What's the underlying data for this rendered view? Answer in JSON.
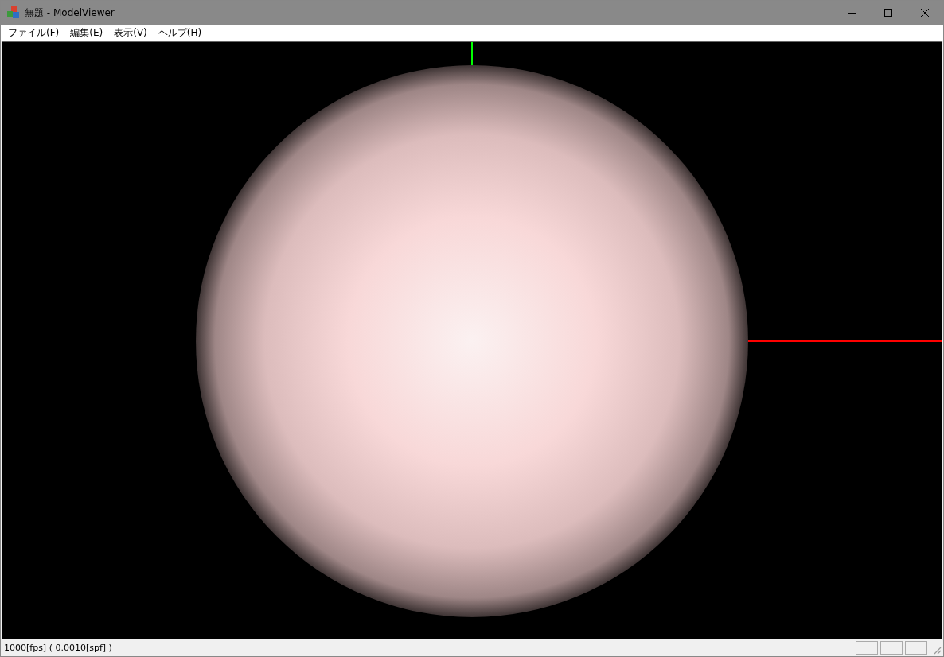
{
  "window": {
    "title": "無題 - ModelViewer"
  },
  "menu": [
    {
      "label": "ファイル(F)"
    },
    {
      "label": "編集(E)"
    },
    {
      "label": "表示(V)"
    },
    {
      "label": "ヘルプ(H)"
    }
  ],
  "status_bar": {
    "text": "1000[fps] ( 0.0010[spf] )"
  }
}
